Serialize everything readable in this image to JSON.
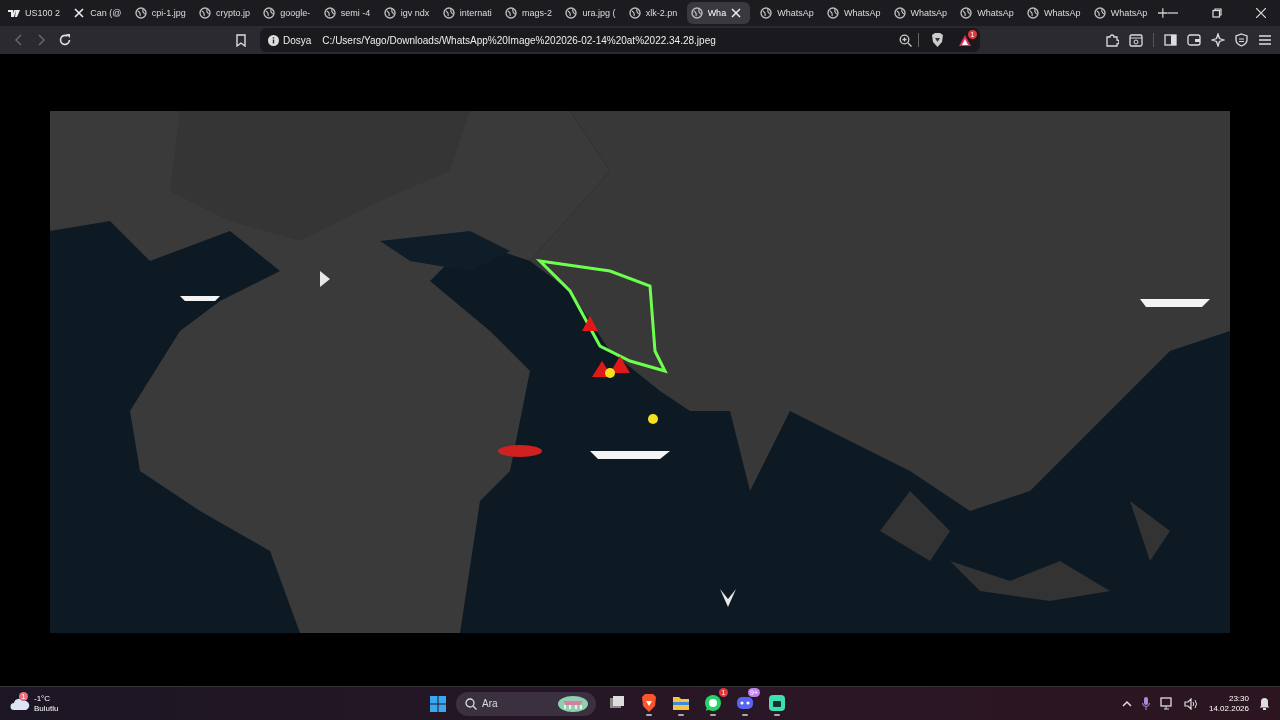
{
  "tabs": [
    {
      "label": "US100 2",
      "kind": "tv",
      "selected": false
    },
    {
      "label": "Can (@",
      "kind": "x",
      "selected": false
    },
    {
      "label": "cpi-1.jpg",
      "kind": "globe",
      "selected": false
    },
    {
      "label": "crypto.jp",
      "kind": "globe",
      "selected": false
    },
    {
      "label": "google-",
      "kind": "globe",
      "selected": false
    },
    {
      "label": "semi -4",
      "kind": "globe",
      "selected": false
    },
    {
      "label": "igv ndx",
      "kind": "globe",
      "selected": false
    },
    {
      "label": "internati",
      "kind": "globe",
      "selected": false
    },
    {
      "label": "mags-2",
      "kind": "globe",
      "selected": false
    },
    {
      "label": "ura.jpg (",
      "kind": "globe",
      "selected": false
    },
    {
      "label": "xlk-2.pn",
      "kind": "globe",
      "selected": false
    },
    {
      "label": "Wha",
      "kind": "globe",
      "selected": true
    },
    {
      "label": "WhatsAp",
      "kind": "globe",
      "selected": false
    },
    {
      "label": "WhatsAp",
      "kind": "globe",
      "selected": false
    },
    {
      "label": "WhatsAp",
      "kind": "globe",
      "selected": false
    },
    {
      "label": "WhatsAp",
      "kind": "globe",
      "selected": false
    },
    {
      "label": "WhatsAp",
      "kind": "globe",
      "selected": false
    },
    {
      "label": "WhatsAp",
      "kind": "globe",
      "selected": false
    }
  ],
  "address": {
    "scheme": "Dosya",
    "url": "C:/Users/Yago/Downloads/WhatsApp%20Image%202026-02-14%20at%2022.34.28.jpeg"
  },
  "alert_badge": "1",
  "taskbar": {
    "weather": {
      "temperature": "-1°C",
      "condition": "Bulutlu",
      "badge": "1"
    },
    "search": {
      "placeholder": "Ara"
    },
    "apps": [
      {
        "kind": "taskview",
        "running": false
      },
      {
        "kind": "brave",
        "running": true
      },
      {
        "kind": "folder",
        "running": true
      },
      {
        "kind": "whatsapp",
        "badge": "1",
        "running": true
      },
      {
        "kind": "discord",
        "badge": "9+",
        "running": true
      },
      {
        "kind": "chat",
        "running": true
      }
    ],
    "time": "23:30",
    "date": "14.02.2026"
  }
}
